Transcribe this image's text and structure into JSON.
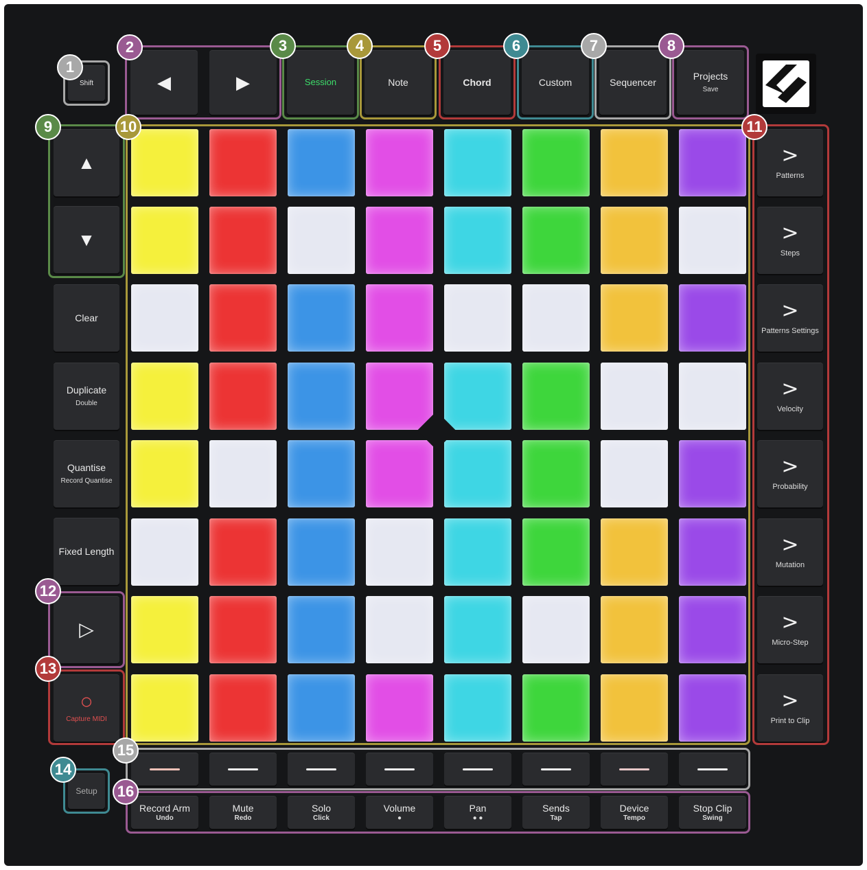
{
  "controller": {
    "nav": {
      "shift": "Shift",
      "left_icon": "◀",
      "right_icon": "▶"
    },
    "modes": [
      {
        "label": "Session",
        "sub": "",
        "color": "#3ddc6a"
      },
      {
        "label": "Note",
        "sub": ""
      },
      {
        "label": "Chord",
        "sub": ""
      },
      {
        "label": "Custom",
        "sub": ""
      },
      {
        "label": "Sequencer",
        "sub": ""
      },
      {
        "label": "Projects",
        "sub": "Save"
      }
    ],
    "arrows": {
      "up_icon": "▲",
      "down_icon": "▼"
    },
    "left_buttons": [
      {
        "label": "Clear",
        "sub": ""
      },
      {
        "label": "Duplicate",
        "sub": "Double"
      },
      {
        "label": "Quantise",
        "sub": "Record Quantise"
      },
      {
        "label": "Fixed Length",
        "sub": ""
      }
    ],
    "play_icon": "▷",
    "capture": {
      "icon": "○",
      "label": "Capture MIDI",
      "color": "#e05050"
    },
    "setup": "Setup",
    "right_buttons": [
      {
        "icon": ">",
        "label": "Patterns"
      },
      {
        "icon": ">",
        "label": "Steps"
      },
      {
        "icon": ">",
        "label": "Patterns Settings"
      },
      {
        "icon": ">",
        "label": "Velocity"
      },
      {
        "icon": ">",
        "label": "Probability"
      },
      {
        "icon": ">",
        "label": "Mutation"
      },
      {
        "icon": ">",
        "label": "Micro-Step"
      },
      {
        "icon": ">",
        "label": "Print to Clip"
      }
    ],
    "track_buttons": [
      {
        "label": "Record Arm",
        "sub": "Undo"
      },
      {
        "label": "Mute",
        "sub": "Redo"
      },
      {
        "label": "Solo",
        "sub": "Click"
      },
      {
        "label": "Volume",
        "sub": "●"
      },
      {
        "label": "Pan",
        "sub": "● ●"
      },
      {
        "label": "Sends",
        "sub": "Tap"
      },
      {
        "label": "Device",
        "sub": "Tempo"
      },
      {
        "label": "Stop Clip",
        "sub": "Swing"
      }
    ],
    "scene_dash_colors": [
      "#f2c2b8",
      "#f2f2f2",
      "#f2f2f2",
      "#f2f2f2",
      "#f2f2f2",
      "#f2f2f2",
      "#e8c8c8",
      "#f2f2f2"
    ]
  },
  "pad_colors": {
    "Y": "#f5f03c",
    "R": "#ec3434",
    "B": "#3c94e6",
    "M": "#e24ee6",
    "C": "#3ed6e4",
    "G": "#3ed63c",
    "O": "#f2c23c",
    "P": "#9a4ae8",
    "W": "#e6e8f2"
  },
  "grid": [
    [
      "Y",
      "R",
      "B",
      "M",
      "C",
      "G",
      "O",
      "P"
    ],
    [
      "Y",
      "R",
      "W",
      "M",
      "C",
      "G",
      "O",
      "W"
    ],
    [
      "W",
      "R",
      "B",
      "M",
      "W",
      "W",
      "O",
      "P"
    ],
    [
      "Y",
      "R",
      "B",
      "M",
      "C",
      "G",
      "W",
      "W"
    ],
    [
      "Y",
      "W",
      "B",
      "M",
      "C",
      "G",
      "W",
      "P"
    ],
    [
      "W",
      "R",
      "B",
      "W",
      "C",
      "G",
      "O",
      "P"
    ],
    [
      "Y",
      "R",
      "B",
      "W",
      "C",
      "W",
      "O",
      "P"
    ],
    [
      "Y",
      "R",
      "B",
      "M",
      "C",
      "G",
      "O",
      "P"
    ]
  ],
  "callouts": [
    {
      "number": "1",
      "color": "#a8a8a8"
    },
    {
      "number": "2",
      "color": "#9a5a92"
    },
    {
      "number": "3",
      "color": "#5a8a48"
    },
    {
      "number": "4",
      "color": "#a8983a"
    },
    {
      "number": "5",
      "color": "#b23a3a"
    },
    {
      "number": "6",
      "color": "#3f8a92"
    },
    {
      "number": "7",
      "color": "#a8a8a8"
    },
    {
      "number": "8",
      "color": "#9a5a92"
    },
    {
      "number": "9",
      "color": "#5a8a48"
    },
    {
      "number": "10",
      "color": "#a8983a"
    },
    {
      "number": "11",
      "color": "#b23a3a"
    },
    {
      "number": "12",
      "color": "#9a5a92"
    },
    {
      "number": "13",
      "color": "#b23a3a"
    },
    {
      "number": "14",
      "color": "#3f8a92"
    },
    {
      "number": "15",
      "color": "#a8a8a8"
    },
    {
      "number": "16",
      "color": "#9a5a92"
    }
  ]
}
